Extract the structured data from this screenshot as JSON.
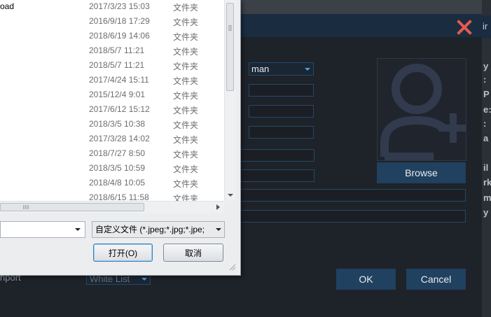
{
  "files": [
    {
      "name": "oad",
      "date": "2017/3/23 15:03",
      "type": "文件夹"
    },
    {
      "name": "",
      "date": "2016/9/18 17:29",
      "type": "文件夹"
    },
    {
      "name": "",
      "date": "2018/6/19 14:06",
      "type": "文件夹"
    },
    {
      "name": "",
      "date": "2018/5/7 11:21",
      "type": "文件夹"
    },
    {
      "name": "",
      "date": "2018/5/7 11:21",
      "type": "文件夹"
    },
    {
      "name": "",
      "date": "2017/4/24 15:11",
      "type": "文件夹"
    },
    {
      "name": "",
      "date": "2015/12/4 9:01",
      "type": "文件夹"
    },
    {
      "name": "",
      "date": "2017/6/12 15:12",
      "type": "文件夹"
    },
    {
      "name": "",
      "date": "2018/3/5 10:38",
      "type": "文件夹"
    },
    {
      "name": "",
      "date": "2017/3/28 14:02",
      "type": "文件夹"
    },
    {
      "name": "",
      "date": "2018/7/27 8:50",
      "type": "文件夹"
    },
    {
      "name": "",
      "date": "2018/3/5 10:59",
      "type": "文件夹"
    },
    {
      "name": "",
      "date": "2018/4/8 10:05",
      "type": "文件夹"
    },
    {
      "name": "",
      "date": "2018/6/15 11:58",
      "type": "文件夹"
    }
  ],
  "dialog": {
    "file_name_value": "",
    "file_type_value": "自定义文件 (*.jpeg;*.jpg;*.jpe;",
    "open_label": "打开(O)",
    "cancel_label": "取消"
  },
  "form": {
    "gender_value": "man",
    "browse_label": "Browse",
    "ok_label": "OK",
    "cancel_label": "Cancel",
    "import_label": "nport",
    "list_type_value": "White List"
  },
  "right_edge_letters": [
    "ir",
    "y",
    ":",
    "P",
    "e:",
    ":",
    "a",
    "il",
    "rk",
    "m",
    "y"
  ],
  "colors": {
    "close_icon": "#e45a4d",
    "accent_blue": "#4aa3df",
    "button_bg": "#20415f"
  }
}
